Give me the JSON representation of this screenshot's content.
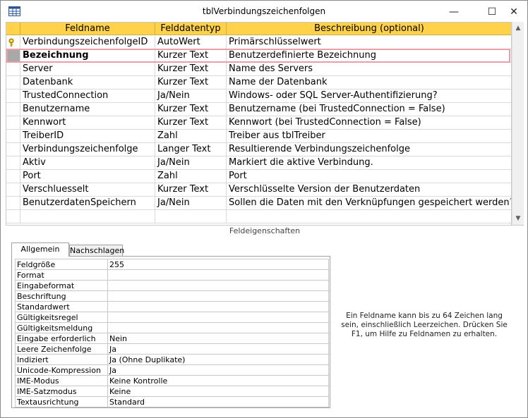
{
  "window": {
    "title": "tblVerbindungszeichenfolgen",
    "controls": {
      "minimize": "—",
      "maximize": "☐",
      "close": "✕"
    }
  },
  "grid": {
    "columns": {
      "name": "Feldname",
      "type": "Felddatentyp",
      "desc": "Beschreibung (optional)"
    },
    "rows": [
      {
        "name": "VerbindungszeichenfolgeID",
        "type": "AutoWert",
        "desc": "Primärschlüsselwert",
        "primary_key": true
      },
      {
        "name": "Bezeichnung",
        "type": "Kurzer Text",
        "desc": "Benutzerdefinierte Bezeichnung",
        "active": true
      },
      {
        "name": "Server",
        "type": "Kurzer Text",
        "desc": "Name des Servers"
      },
      {
        "name": "Datenbank",
        "type": "Kurzer Text",
        "desc": "Name der Datenbank"
      },
      {
        "name": "TrustedConnection",
        "type": "Ja/Nein",
        "desc": "Windows- oder SQL Server-Authentifizierung?"
      },
      {
        "name": "Benutzername",
        "type": "Kurzer Text",
        "desc": "Benutzername (bei TrustedConnection = False)"
      },
      {
        "name": "Kennwort",
        "type": "Kurzer Text",
        "desc": "Kennwort (bei TrustedConnection = False)"
      },
      {
        "name": "TreiberID",
        "type": "Zahl",
        "desc": "Treiber aus tblTreiber"
      },
      {
        "name": "Verbindungszeichenfolge",
        "type": "Langer Text",
        "desc": "Resultierende Verbindungszeichenfolge"
      },
      {
        "name": "Aktiv",
        "type": "Ja/Nein",
        "desc": "Markiert die aktive Verbindung."
      },
      {
        "name": "Port",
        "type": "Zahl",
        "desc": "Port"
      },
      {
        "name": "Verschluesselt",
        "type": "Kurzer Text",
        "desc": "Verschlüsselte Version der Benutzerdaten"
      },
      {
        "name": "BenutzerdatenSpeichern",
        "type": "Ja/Nein",
        "desc": "Sollen die Daten mit den Verknüpfungen gespeichert werden?"
      },
      {
        "name": "",
        "type": "",
        "desc": ""
      }
    ]
  },
  "properties": {
    "section_label": "Feldeigenschaften",
    "tabs": [
      "Allgemein",
      "Nachschlagen"
    ],
    "rows": [
      {
        "name": "Feldgröße",
        "value": "255"
      },
      {
        "name": "Format",
        "value": ""
      },
      {
        "name": "Eingabeformat",
        "value": ""
      },
      {
        "name": "Beschriftung",
        "value": ""
      },
      {
        "name": "Standardwert",
        "value": ""
      },
      {
        "name": "Gültigkeitsregel",
        "value": ""
      },
      {
        "name": "Gültigkeitsmeldung",
        "value": ""
      },
      {
        "name": "Eingabe erforderlich",
        "value": "Nein"
      },
      {
        "name": "Leere Zeichenfolge",
        "value": "Ja"
      },
      {
        "name": "Indiziert",
        "value": "Ja (Ohne Duplikate)"
      },
      {
        "name": "Unicode-Kompression",
        "value": "Ja"
      },
      {
        "name": "IME-Modus",
        "value": "Keine Kontrolle"
      },
      {
        "name": "IME-Satzmodus",
        "value": "Keine"
      },
      {
        "name": "Textausrichtung",
        "value": "Standard"
      }
    ],
    "help": "Ein Feldname kann bis zu 64 Zeichen lang sein, einschließlich Leerzeichen. Drücken Sie F1, um Hilfe zu Feldnamen zu erhalten."
  },
  "colors": {
    "header": "#ffd24a",
    "active_outline": "#e8a0a8",
    "selector_active": "#a8a8a8"
  },
  "icons": {
    "app": "table-icon",
    "key": "key-icon",
    "scroll_up": "scroll-up-icon",
    "scroll_down": "scroll-down-icon"
  }
}
